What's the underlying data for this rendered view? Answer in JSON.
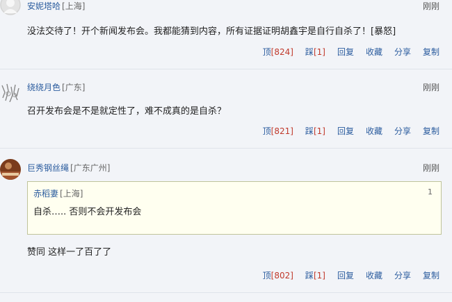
{
  "comments": [
    {
      "user": "安妮塔哈",
      "location": "[上海]",
      "time": "刚刚",
      "text": "没法交待了！开个新闻发布会。我都能猜到内容，所有证据证明胡鑫宇是自行自杀了！[暴怒]",
      "actions": {
        "up_label": "顶",
        "up_count": "[824]",
        "down_label": "踩",
        "down_count": "[1]",
        "reply": "回复",
        "collect": "收藏",
        "share": "分享",
        "copy": "复制"
      }
    },
    {
      "user": "绕绕月色",
      "location": "[广东]",
      "time": "刚刚",
      "text": "召开发布会是不是就定性了，难不成真的是自杀？",
      "actions": {
        "up_label": "顶",
        "up_count": "[821]",
        "down_label": "踩",
        "down_count": "[1]",
        "reply": "回复",
        "collect": "收藏",
        "share": "分享",
        "copy": "复制"
      }
    },
    {
      "user": "巨秀钢丝绳",
      "location": "[广东广州]",
      "time": "刚刚",
      "quote": {
        "user": "赤稻妻",
        "location": "[上海]",
        "floor": "1",
        "text": "自杀….. 否则不会开发布会"
      },
      "text": "赞同 这样一了百了了",
      "actions": {
        "up_label": "顶",
        "up_count": "[802]",
        "down_label": "踩",
        "down_count": "[1]",
        "reply": "回复",
        "collect": "收藏",
        "share": "分享",
        "copy": "复制"
      }
    }
  ]
}
